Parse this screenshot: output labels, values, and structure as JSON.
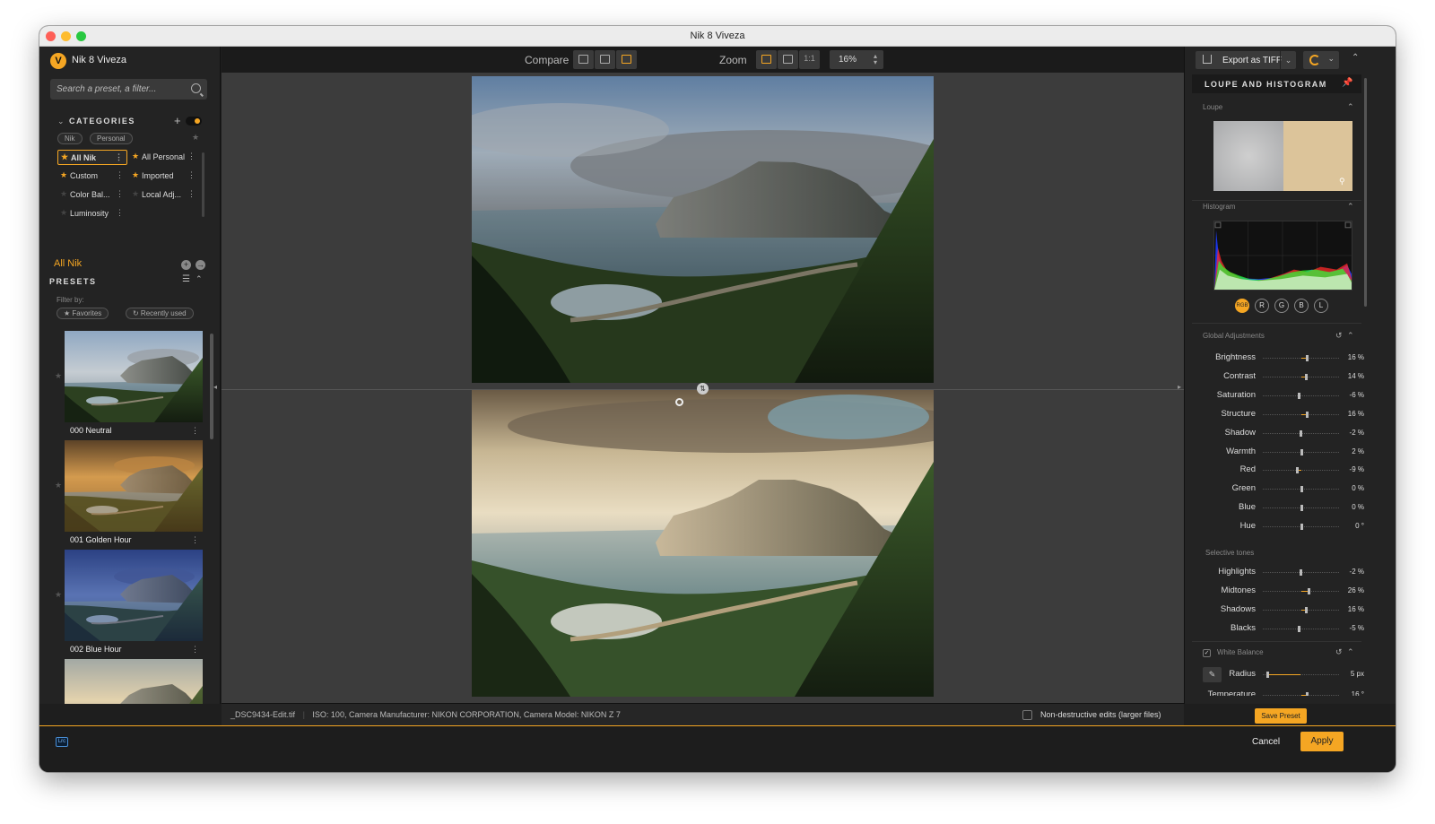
{
  "window": {
    "title": "Nik 8 Viveza"
  },
  "sidebar": {
    "app_name": "Nik 8 Viveza",
    "search_placeholder": "Search a preset, a filter...",
    "categories_label": "CATEGORIES",
    "chips": [
      "Nik",
      "Personal"
    ],
    "categories": [
      {
        "label": "All Nik",
        "selected": true,
        "starred": true
      },
      {
        "label": "All Personal",
        "selected": false,
        "starred": true
      },
      {
        "label": "Custom",
        "selected": false,
        "starred": true
      },
      {
        "label": "Imported",
        "selected": false,
        "starred": true
      },
      {
        "label": "Color Bal...",
        "selected": false,
        "starred": false
      },
      {
        "label": "Local Adj...",
        "selected": false,
        "starred": false
      },
      {
        "label": "Luminosity",
        "selected": false,
        "starred": false
      }
    ],
    "current_category": "All Nik",
    "presets_label": "PRESETS",
    "filter_by": "Filter by:",
    "filters": [
      "★ Favorites",
      "↻ Recently used"
    ],
    "presets": [
      {
        "name": "000 Neutral",
        "tone": "neutral"
      },
      {
        "name": "001 Golden Hour",
        "tone": "golden"
      },
      {
        "name": "002 Blue Hour",
        "tone": "blue"
      },
      {
        "name": "",
        "tone": "warm"
      }
    ]
  },
  "toolbar": {
    "compare_label": "Compare",
    "zoom_label": "Zoom",
    "zoom_one_to_one": "1:1",
    "zoom_value": "16%"
  },
  "statusbar": {
    "filename": "_DSC9434-Edit.tif",
    "metadata": "ISO: 100, Camera Manufacturer: NIKON CORPORATION, Camera Model: NIKON Z 7",
    "non_destructive_label": "Non-destructive edits (larger files)"
  },
  "rpanel": {
    "export_label": "Export as TIFF",
    "section_title": "LOUPE AND HISTOGRAM",
    "loupe_label": "Loupe",
    "histogram_label": "Histogram",
    "channels": [
      "RGB",
      "R",
      "G",
      "B",
      "L"
    ],
    "global_label": "Global Adjustments",
    "global": [
      {
        "label": "Brightness",
        "value": "16 %",
        "pos": 0.58
      },
      {
        "label": "Contrast",
        "value": "14 %",
        "pos": 0.57
      },
      {
        "label": "Saturation",
        "value": "-6 %",
        "pos": 0.47
      },
      {
        "label": "Structure",
        "value": "16 %",
        "pos": 0.58
      },
      {
        "label": "Shadow",
        "value": "-2 %",
        "pos": 0.49
      },
      {
        "label": "Warmth",
        "value": "2 %",
        "pos": 0.51
      },
      {
        "label": "Red",
        "value": "-9 %",
        "pos": 0.45
      },
      {
        "label": "Green",
        "value": "0 %",
        "pos": 0.5
      },
      {
        "label": "Blue",
        "value": "0 %",
        "pos": 0.5
      },
      {
        "label": "Hue",
        "value": "0 °",
        "pos": 0.5
      }
    ],
    "selective_label": "Selective tones",
    "selective": [
      {
        "label": "Highlights",
        "value": "-2 %",
        "pos": 0.49
      },
      {
        "label": "Midtones",
        "value": "26 %",
        "pos": 0.6
      },
      {
        "label": "Shadows",
        "value": "16 %",
        "pos": 0.57
      },
      {
        "label": "Blacks",
        "value": "-5 %",
        "pos": 0.47
      }
    ],
    "wb_label": "White Balance",
    "wb_rows": [
      {
        "label": "Radius",
        "value": "5 px",
        "pos": 0.06
      },
      {
        "label": "Temperature",
        "value": "16 °",
        "pos": 0.58
      }
    ],
    "save_preset": "Save Preset"
  },
  "bottombar": {
    "lrc_badge": "Lrc",
    "cancel": "Cancel",
    "apply": "Apply"
  },
  "colors": {
    "accent": "#f5a623",
    "panel": "#232323",
    "canvas": "#3c3c3c"
  }
}
